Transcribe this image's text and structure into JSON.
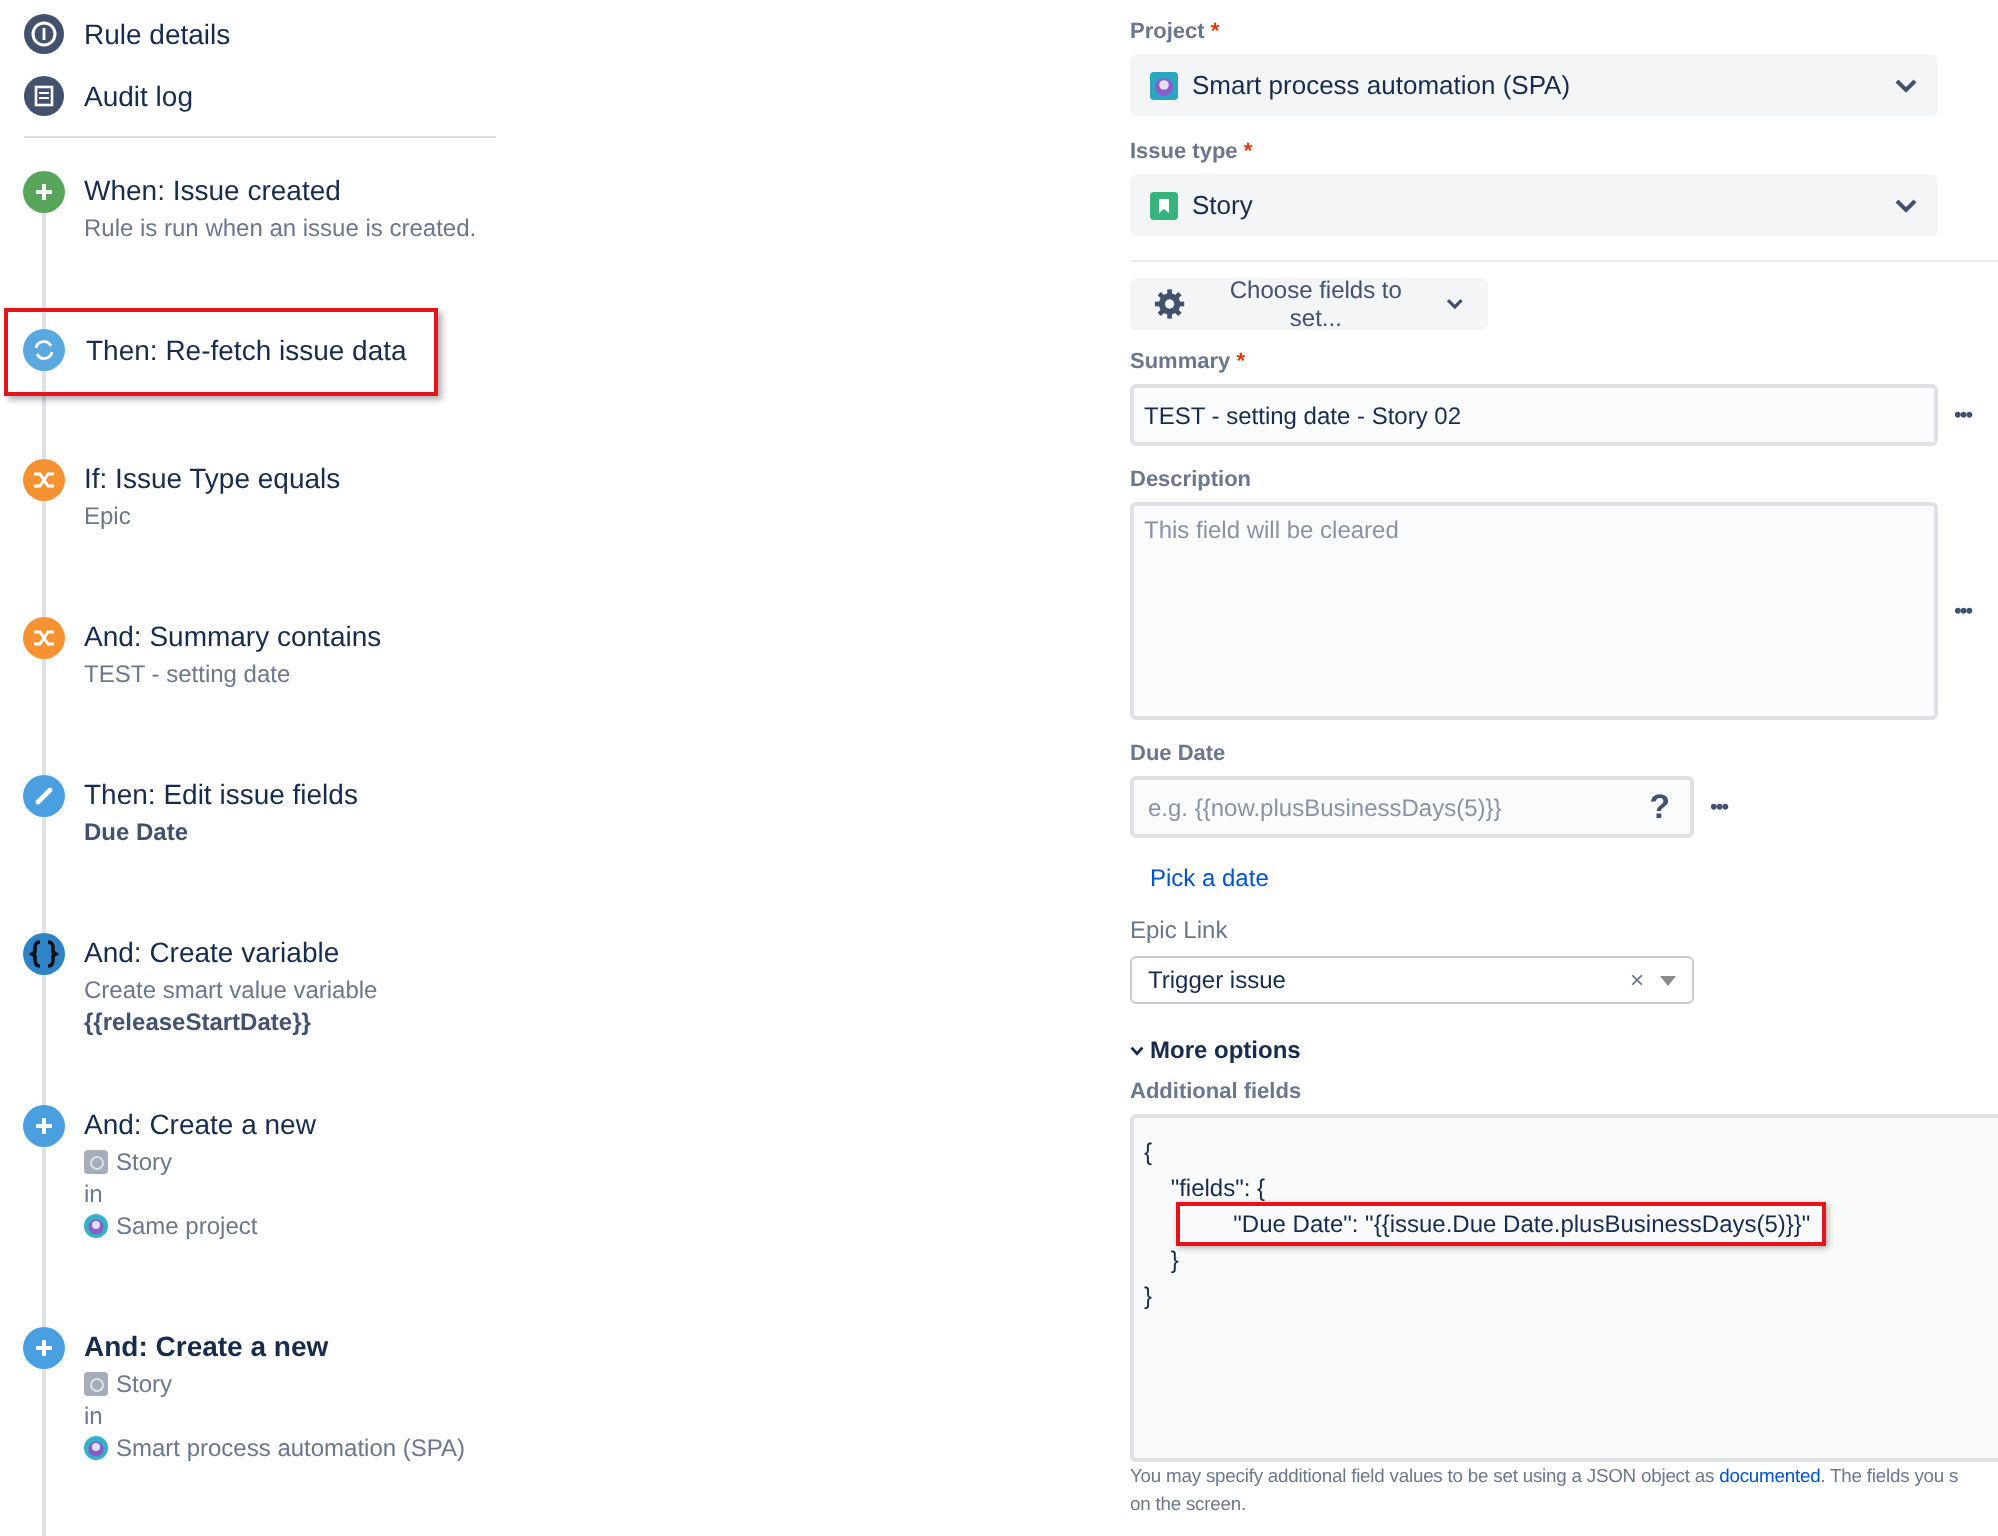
{
  "nav": [
    {
      "kind": "info",
      "label": "Rule details"
    },
    {
      "kind": "log",
      "label": "Audit log"
    }
  ],
  "steps": [
    {
      "kind": "trigger",
      "title": "When: Issue created",
      "selected": false,
      "highlighted": false,
      "details": [
        {
          "kind": "text",
          "text": "Rule is run when an issue is created."
        }
      ]
    },
    {
      "kind": "refetch",
      "title": "Then: Re-fetch issue data",
      "selected": false,
      "highlighted": true
    },
    {
      "kind": "condition",
      "title": "If: Issue Type equals",
      "selected": false,
      "highlighted": false,
      "details": [
        {
          "kind": "text",
          "text": "Epic"
        }
      ]
    },
    {
      "kind": "condition",
      "title": "And: Summary contains",
      "selected": false,
      "highlighted": false,
      "details": [
        {
          "kind": "text",
          "text": "TEST - setting date"
        }
      ]
    },
    {
      "kind": "edit",
      "title": "Then: Edit issue fields",
      "selected": false,
      "highlighted": false,
      "details": [
        {
          "kind": "bold",
          "text": "Due Date"
        }
      ]
    },
    {
      "kind": "variable",
      "title": "And: Create variable",
      "selected": false,
      "highlighted": false,
      "details": [
        {
          "kind": "text",
          "text": "Create smart value variable"
        },
        {
          "kind": "bold",
          "text": "{{releaseStartDate}}"
        }
      ]
    },
    {
      "kind": "create",
      "title": "And: Create a new",
      "selected": false,
      "highlighted": false,
      "details": [
        {
          "kind": "issuetype",
          "text": "Story"
        },
        {
          "kind": "text",
          "text": "in"
        },
        {
          "kind": "project",
          "text": "Same project"
        }
      ]
    },
    {
      "kind": "create",
      "title": "And: Create a new",
      "selected": true,
      "highlighted": false,
      "details": [
        {
          "kind": "issuetype",
          "text": "Story"
        },
        {
          "kind": "text",
          "text": "in"
        },
        {
          "kind": "project",
          "text": "Smart process automation (SPA)"
        }
      ]
    }
  ],
  "project": {
    "label": "Project",
    "required_mark": "*",
    "value": "Smart process automation (SPA)"
  },
  "issue_type": {
    "label": "Issue type",
    "required_mark": "*",
    "value": "Story"
  },
  "choose_fields": "Choose fields to set...",
  "summary": {
    "label": "Summary",
    "required_mark": "*",
    "value": "TEST - setting date - Story 02",
    "more": "•••"
  },
  "description": {
    "label": "Description",
    "placeholder": "This field will be cleared",
    "more": "•••"
  },
  "due_date": {
    "label": "Due Date",
    "placeholder": "e.g. {{now.plusBusinessDays(5)}}",
    "help": "?",
    "more": "•••",
    "link": "Pick a date"
  },
  "epic_link": {
    "label": "Epic Link",
    "value": "Trigger issue",
    "clear": "×"
  },
  "more_options": {
    "label": "More options",
    "expanded": true
  },
  "additional_fields": {
    "label": "Additional fields",
    "code": [
      {
        "text": "{",
        "highlighted": false
      },
      {
        "text": "    \"fields\": {",
        "highlighted": false
      },
      {
        "text": "        \"Due Date\": \"{{issue.Due Date.plusBusinessDays(5)}}\"",
        "highlighted": true
      },
      {
        "text": "    }",
        "highlighted": false
      },
      {
        "text": "}",
        "highlighted": false
      }
    ],
    "help_before": "You may specify additional field values to be set using a JSON object as",
    "help_link": "documented",
    "help_after": ". The fields you s",
    "help_line2": "on the screen."
  }
}
